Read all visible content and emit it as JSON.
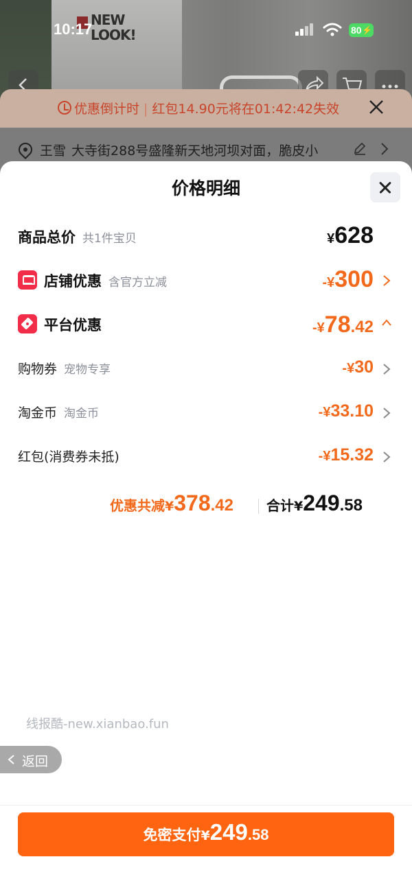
{
  "status_bar": {
    "time": "10:17",
    "battery": "80"
  },
  "background_product": {
    "logo_text": "NEW LOOK!"
  },
  "countdown_banner": {
    "label": "优惠倒计时",
    "message": "红包14.90元将在01:42:42失效"
  },
  "address": {
    "name": "王雪",
    "text": "大寺街288号盛隆新天地河坝对面，脆皮小"
  },
  "sheet": {
    "title": "价格明细",
    "rows": [
      {
        "label": "商品总价",
        "sub": "共1件宝贝",
        "sign": "",
        "yen": "¥",
        "int": "628",
        "dec": ""
      },
      {
        "label": "店铺优惠",
        "sub": "含官方立减",
        "sign": "-",
        "yen": "¥",
        "int": "300",
        "dec": ""
      },
      {
        "label": "平台优惠",
        "sub": "",
        "sign": "-",
        "yen": "¥",
        "int": "78",
        "dec": ".42"
      },
      {
        "label": "购物券",
        "sub": "宠物专享",
        "sign": "-",
        "yen": "¥",
        "int": "30",
        "dec": ""
      },
      {
        "label": "淘金币",
        "sub": "淘金币",
        "sign": "-",
        "yen": "¥",
        "int": "33.10",
        "dec": ""
      },
      {
        "label": "红包(消费券未抵)",
        "sub": "",
        "sign": "-",
        "yen": "¥",
        "int": "15.32",
        "dec": ""
      }
    ],
    "summary": {
      "discount_label": "优惠共减",
      "discount_yen": "¥",
      "discount_int": "378",
      "discount_dec": ".42",
      "total_label": "合计",
      "total_yen": "¥",
      "total_int": "249",
      "total_dec": ".58"
    },
    "watermark": "线报酷-new.xianbao.fun",
    "back_label": "返回",
    "pay_button": {
      "label": "免密支付",
      "yen": "¥",
      "int": "249",
      "dec": ".58"
    }
  },
  "colors": {
    "accent_orange": "#f2691b",
    "pay_button": "#ff6510",
    "icon_red": "#f22d49",
    "banner_text": "#c8452c"
  },
  "icons": {
    "close": "close-icon",
    "shop": "shop-icon",
    "coupon": "coupon-tag-icon",
    "location": "location-pin-icon",
    "edit": "edit-pencil-icon",
    "chevron_right": "chevron-right-icon",
    "chevron_up": "chevron-up-icon",
    "clock": "clock-icon"
  }
}
